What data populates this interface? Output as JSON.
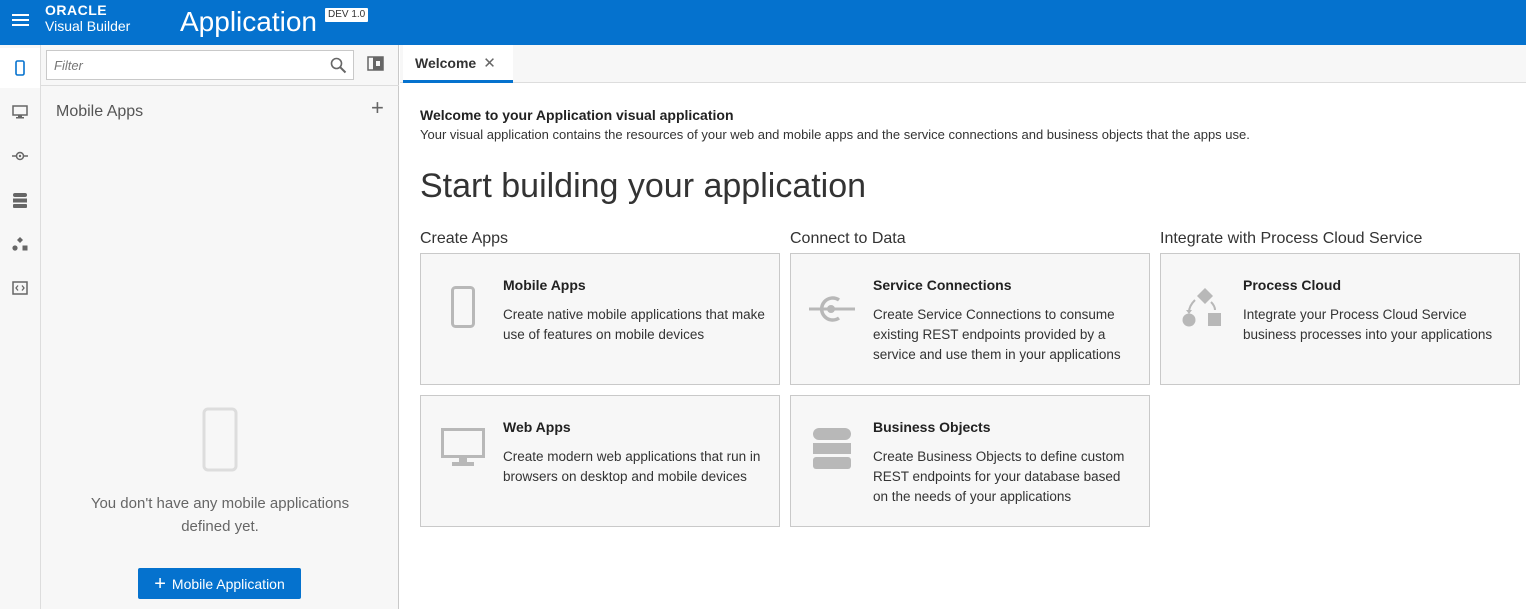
{
  "header": {
    "brand_top": "ORACLE",
    "brand_bottom": "Visual Builder",
    "app_title": "Application",
    "version_badge": "DEV 1.0"
  },
  "rail": {
    "items": [
      "mobile-apps",
      "web-apps",
      "service-connections",
      "business-objects",
      "processes",
      "source-view"
    ]
  },
  "navigator": {
    "filter_placeholder": "Filter",
    "section_title": "Mobile Apps",
    "add_label": "+",
    "empty_message": "You don't have any mobile applications defined yet.",
    "add_button_label": "Mobile Application"
  },
  "tabs": [
    {
      "label": "Welcome",
      "close": "✕"
    }
  ],
  "welcome": {
    "title": "Welcome to your Application visual application",
    "description": "Your visual application contains the resources of your web and mobile apps and the service connections and business objects that the apps use.",
    "headline": "Start building your application"
  },
  "columns": [
    {
      "title": "Create Apps",
      "cards": [
        {
          "title": "Mobile Apps",
          "description": "Create native mobile applications that make use of features on mobile devices",
          "icon": "mobile-icon"
        },
        {
          "title": "Web Apps",
          "description": "Create modern web applications that run in browsers on desktop and mobile devices",
          "icon": "desktop-icon"
        }
      ]
    },
    {
      "title": "Connect to Data",
      "cards": [
        {
          "title": "Service Connections",
          "description": "Create Service Connections to consume existing REST endpoints provided by a service and use them in your applications",
          "icon": "service-connection-icon"
        },
        {
          "title": "Business Objects",
          "description": "Create Business Objects to define custom REST endpoints for your database based on the needs of your applications",
          "icon": "database-icon"
        }
      ]
    },
    {
      "title": "Integrate with Process Cloud Service",
      "cards": [
        {
          "title": "Process Cloud",
          "description": "Integrate your Process Cloud Service business processes into your applications",
          "icon": "process-icon"
        }
      ]
    }
  ],
  "colors": {
    "brand_blue": "#0572ce",
    "panel_bg": "#f7f7f7",
    "icon_gray": "#b8b8b8"
  }
}
